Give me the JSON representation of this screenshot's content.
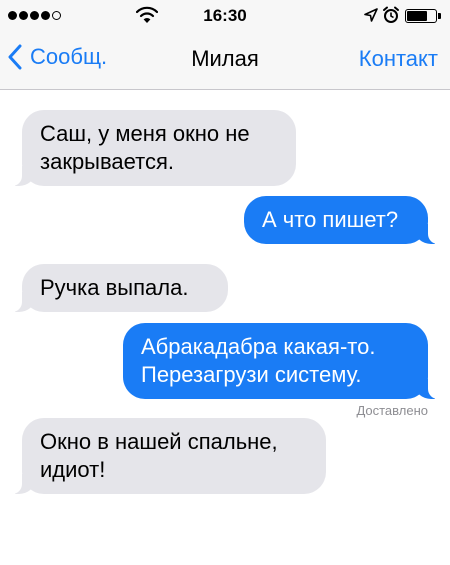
{
  "status_bar": {
    "signal_dots_filled": 4,
    "signal_dots_total": 5,
    "time": "16:30",
    "icons": [
      "wifi-icon",
      "location-icon",
      "alarm-icon",
      "battery-icon"
    ]
  },
  "nav": {
    "back_label": "Сообщ.",
    "title": "Милая",
    "contact_label": "Контакт"
  },
  "messages": [
    {
      "direction": "incoming",
      "lines": [
        "Саш, у меня окно не",
        "закрывается."
      ]
    },
    {
      "direction": "outgoing",
      "lines": [
        "А что пишет?"
      ]
    },
    {
      "direction": "incoming",
      "lines": [
        "Ручка выпала."
      ]
    },
    {
      "direction": "outgoing",
      "lines": [
        "Абракадабра какая-то.",
        "Перезагрузи систему."
      ]
    },
    {
      "direction": "incoming",
      "lines": [
        "Окно в нашей спальне,",
        "идиот!"
      ]
    }
  ],
  "delivery_status": "Доставлено",
  "colors": {
    "accent": "#1a7cf5",
    "incoming_bubble": "#e5e5ea",
    "outgoing_bubble": "#1a7cf5",
    "bar_background": "#f7f7f7"
  }
}
